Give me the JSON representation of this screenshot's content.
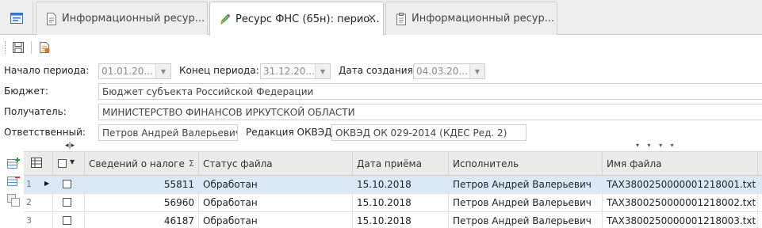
{
  "tabs": [
    {
      "label": "Информационный ресур...",
      "icon": "document-icon",
      "active": false
    },
    {
      "label": "Ресурс ФНС (65н): перио...",
      "icon": "pencil-icon",
      "active": true,
      "close": "×"
    },
    {
      "label": "Информационный ресур...",
      "icon": "clipboard-icon",
      "active": false
    }
  ],
  "toolbar": {
    "save_icon": "save-icon",
    "export_icon": "export-icon"
  },
  "form": {
    "period_start_label": "Начало периода:",
    "period_start_value": "01.01.20...",
    "period_end_label": "Конец периода:",
    "period_end_value": "31.12.20...",
    "created_label": "Дата создания:",
    "created_value": "04.03.20...",
    "budget_label": "Бюджет:",
    "budget_value": "Бюджет субъекта Российской Федерации",
    "recipient_label": "Получатель:",
    "recipient_value": "МИНИСТЕРСТВО ФИНАНСОВ ИРКУТСКОЙ ОБЛАСТИ",
    "responsible_label": "Ответственный:",
    "responsible_value": "Петров Андрей Валерьевич",
    "okved_label": "Редакция ОКВЭД:",
    "okved_value": "ОКВЭД ОК 029-2014 (КДЕС Ред. 2)"
  },
  "grid": {
    "columns": [
      "Сведений о налоге",
      "Статус файла",
      "Дата приёма",
      "Исполнитель",
      "Имя файла"
    ],
    "sum_marker": "Σ",
    "rows": [
      {
        "num": "1",
        "amount": "55811",
        "status": "Обработан",
        "date": "15.10.2018",
        "executor": "Петров Андрей Валерьевич",
        "file": "TAX3800250000001218001.txt",
        "selected": true
      },
      {
        "num": "2",
        "amount": "56960",
        "status": "Обработан",
        "date": "15.10.2018",
        "executor": "Петров Андрей Валерьевич",
        "file": "TAX3800250000001218002.txt",
        "selected": false
      },
      {
        "num": "3",
        "amount": "46187",
        "status": "Обработан",
        "date": "15.10.2018",
        "executor": "Петров Андрей Валерьевич",
        "file": "TAX3800250000001218003.txt",
        "selected": false
      }
    ]
  },
  "colors": {
    "accent": "#2b6cb0",
    "selected_row": "#dbe9f7",
    "pencil": "#4caf50"
  }
}
